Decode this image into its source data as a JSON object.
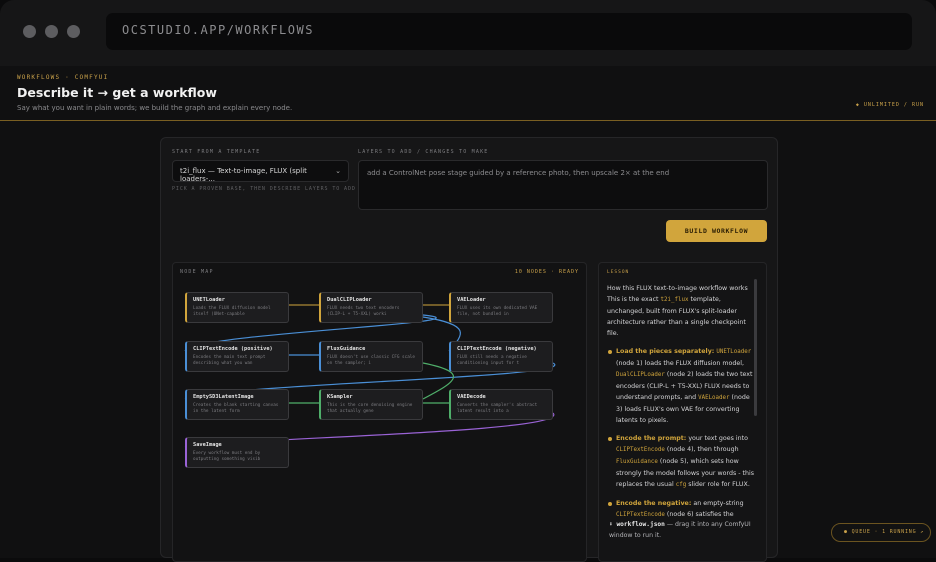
{
  "browser": {
    "url": "OCSTUDIO.APP/WORKFLOWS"
  },
  "header": {
    "breadcrumb": "WORKFLOWS · COMFYUI",
    "title": "Describe it → get a workflow",
    "subtitle": "Say what you want in plain words; we build the graph and explain every node.",
    "meta": "◆ UNLIMITED / RUN"
  },
  "form": {
    "template_label": "START FROM A TEMPLATE",
    "template_value": "t2i_flux — Text-to-image, FLUX (split loaders-...",
    "template_hint": "PICK A PROVEN BASE, THEN DESCRIBE LAYERS TO ADD",
    "layers_label": "LAYERS TO ADD / CHANGES TO MAKE",
    "layers_value": "add a ControlNet pose stage guided by a reference photo, then upscale 2× at the end",
    "build_button": "BUILD WORKFLOW"
  },
  "node_map": {
    "label": "NODE MAP",
    "status": "10 NODES · READY",
    "nodes": [
      {
        "title": "UNETLoader",
        "desc": "Loads the FLUX diffusion model itself (UNet-capable"
      },
      {
        "title": "DualCLIPLoader",
        "desc": "FLUX needs two text encoders (CLIP-L + T5-XXL) worki"
      },
      {
        "title": "VAELoader",
        "desc": "FLUX uses its own dedicated VAE file, not bundled in"
      },
      {
        "title": "CLIPTextEncode (positive)",
        "desc": "Encodes the main text prompt describing what you wan"
      },
      {
        "title": "FluxGuidance",
        "desc": "FLUX doesn't use classic CFG scale on the sampler; i"
      },
      {
        "title": "CLIPTextEncode (negative)",
        "desc": "FLUX still needs a negative conditioning input for t"
      },
      {
        "title": "EmptySD3LatentImage",
        "desc": "Creates the blank starting canvas in the latent form"
      },
      {
        "title": "KSampler",
        "desc": "This is the core denoising engine that actually gene"
      },
      {
        "title": "VAEDecode",
        "desc": "Converts the sampler's abstract latent result into a"
      },
      {
        "title": "SaveImage",
        "desc": "Every workflow must end by outputting something visib"
      }
    ]
  },
  "lesson": {
    "label": "LESSON",
    "intro_heading": "How this FLUX text-to-image workflow works",
    "intro_a": "This is the exact",
    "intro_code": "t2i_flux",
    "intro_b": "template, unchanged, built from FLUX's split-loader architecture rather than a single checkpoint file.",
    "b1_title": "Load the pieces separately:",
    "b1_code1": "UNETLoader",
    "b1_t1": "(node 1) loads the FLUX diffusion model,",
    "b1_code2": "DualCLIPLoader",
    "b1_t2": "(node 2) loads the two text encoders (CLIP-L + T5-XXL) FLUX needs to understand prompts, and",
    "b1_code3": "VAELoader",
    "b1_t3": "(node 3) loads FLUX's own VAE for converting latents to pixels.",
    "b2_title": "Encode the prompt:",
    "b2_t1": "your text goes into",
    "b2_code1": "CLIPTextEncode",
    "b2_t2": "(node 4), then through",
    "b2_code2": "FluxGuidance",
    "b2_t3": "(node 5), which sets how strongly the model follows your words - this replaces the usual",
    "b2_code3": "cfg",
    "b2_t4": "slider role for FLUX.",
    "b3_title": "Encode the negative:",
    "b3_t1": "an empty-string",
    "b3_code1": "CLIPTextEncode",
    "b3_t2": "(node 6) satisfies the"
  },
  "footnote": {
    "text1": "⬇ workflow.json",
    "text2": "— drag it into any ComfyUI window to run it."
  },
  "queue": {
    "label": "● QUEUE · 1 RUNNING ↗"
  },
  "colors": {
    "accent": "#d1a53c",
    "loader": "#d1a53c",
    "encode": "#4a8fd6",
    "sampler": "#4fae6a",
    "save": "#9a63d6"
  }
}
